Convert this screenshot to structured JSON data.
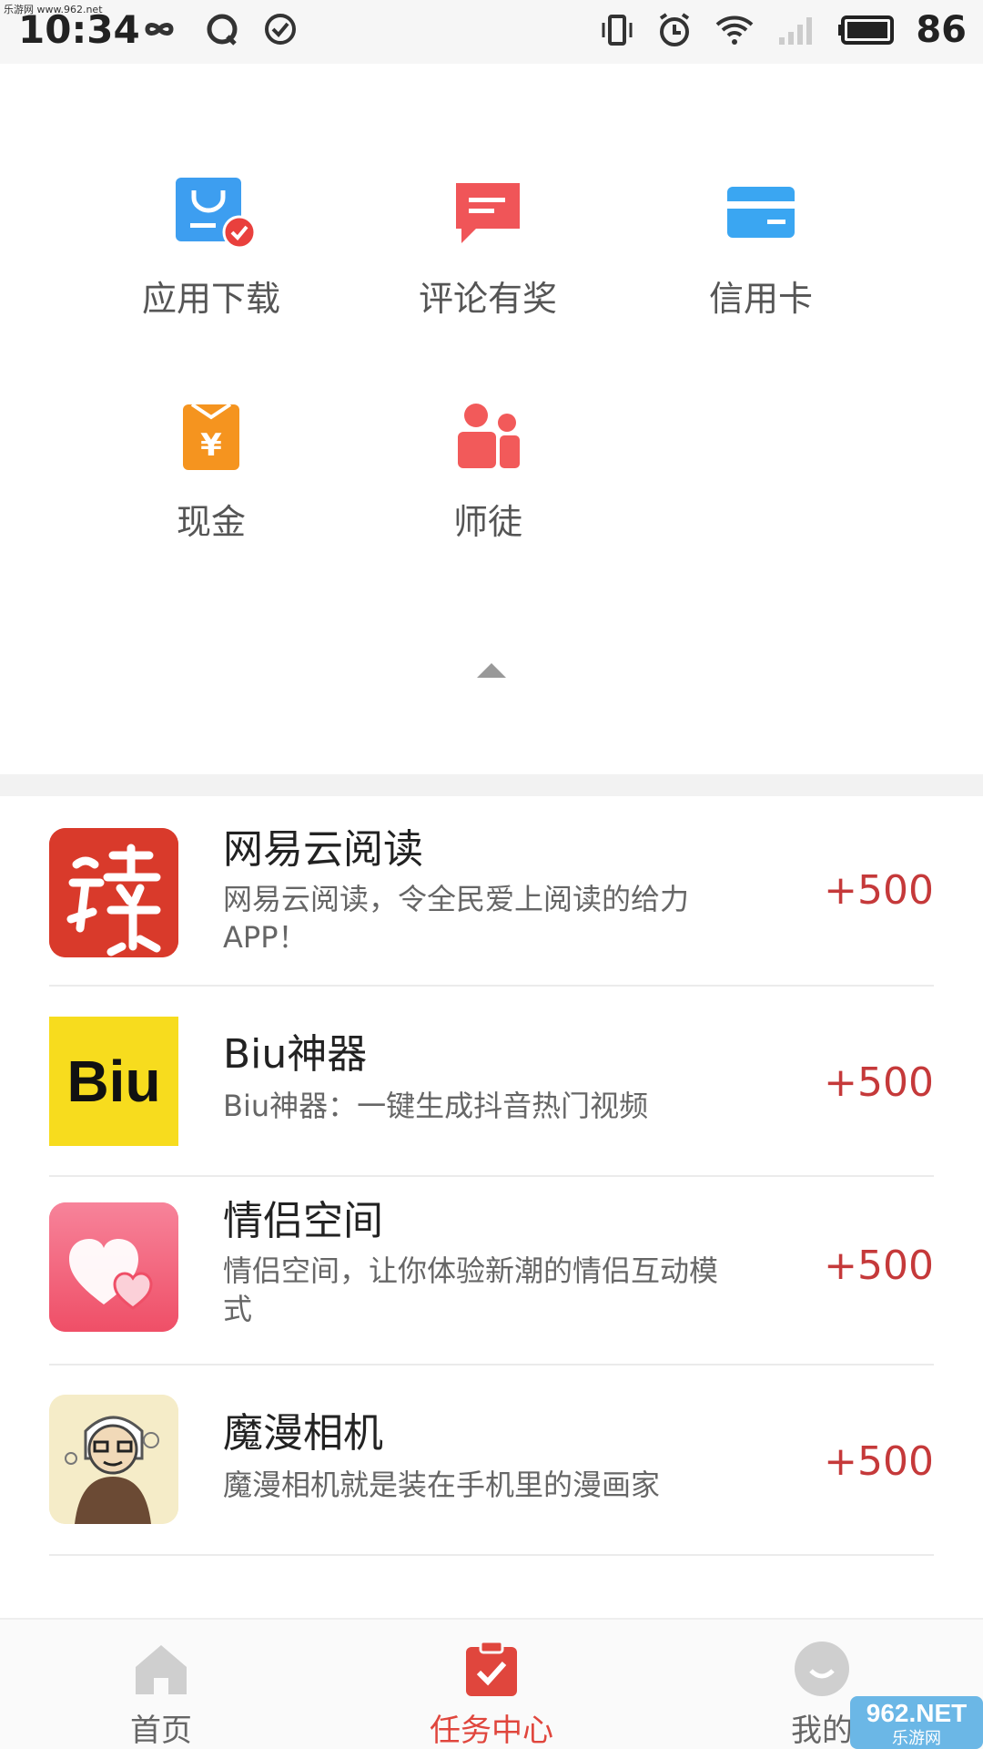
{
  "status_bar": {
    "time": "10:34",
    "battery": "86",
    "watermark": "乐游网 www.962.net"
  },
  "categories": [
    {
      "label": "应用下载",
      "icon": "download-bag-icon",
      "color": "#3d9ef0"
    },
    {
      "label": "评论有奖",
      "icon": "comment-icon",
      "color": "#f05558"
    },
    {
      "label": "信用卡",
      "icon": "credit-card-icon",
      "color": "#3aa6f2"
    },
    {
      "label": "现金",
      "icon": "cash-bag-icon",
      "color": "#f5941f"
    },
    {
      "label": "师徒",
      "icon": "mentor-icon",
      "color": "#f25a5a"
    }
  ],
  "apps": [
    {
      "name": "网易云阅读",
      "desc": "网易云阅读，令全民爱上阅读的给力APP！",
      "reward": "+500",
      "thumb": "reading-app-logo"
    },
    {
      "name": "Biu神器",
      "desc": "Biu神器：一键生成抖音热门视频",
      "reward": "+500",
      "thumb": "biu-app-logo",
      "thumb_text": "Biu"
    },
    {
      "name": "情侣空间",
      "desc": "情侣空间，让你体验新潮的情侣互动模式",
      "reward": "+500",
      "thumb": "couple-app-logo"
    },
    {
      "name": "魔漫相机",
      "desc": "魔漫相机就是装在手机里的漫画家",
      "reward": "+500",
      "thumb": "cartoon-camera-logo"
    }
  ],
  "nav": {
    "home": "首页",
    "tasks": "任务中心",
    "mine": "我的",
    "accent": "#e0463d"
  },
  "watermark_logo": {
    "text": "962.NET",
    "sub": "乐游网"
  }
}
